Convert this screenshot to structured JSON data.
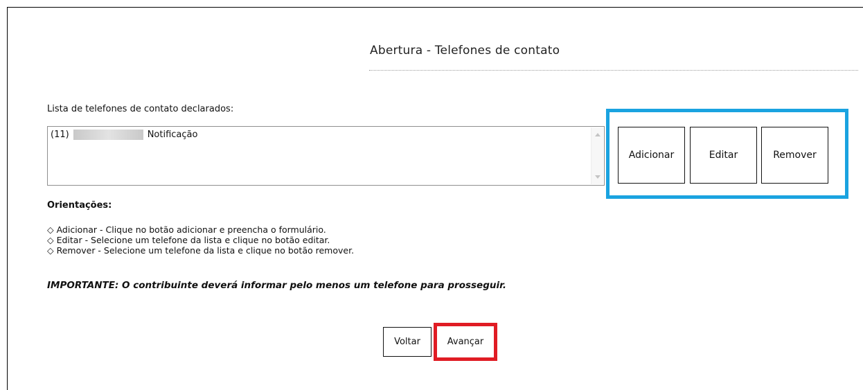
{
  "page": {
    "title": "Abertura - Telefones de contato"
  },
  "contacts": {
    "label": "Lista de telefones de contato declarados:",
    "items": [
      {
        "ddd": "(11)",
        "type": "Notificação"
      }
    ]
  },
  "actions": {
    "add_label": "Adicionar",
    "edit_label": "Editar",
    "remove_label": "Remover"
  },
  "guidance": {
    "title": "Orientações:",
    "items": [
      "◇ Adicionar - Clique no botão adicionar e preencha o formulário.",
      "◇ Editar - Selecione um telefone da lista e clique no botão editar.",
      "◇ Remover - Selecione um telefone da lista e clique no botão remover."
    ],
    "important": "IMPORTANTE: O contribuinte deverá informar pelo menos um telefone para prosseguir."
  },
  "footer": {
    "back_label": "Voltar",
    "next_label": "Avançar"
  },
  "highlights": {
    "actions_color": "#1aa3e0",
    "next_color": "#e01c24"
  }
}
